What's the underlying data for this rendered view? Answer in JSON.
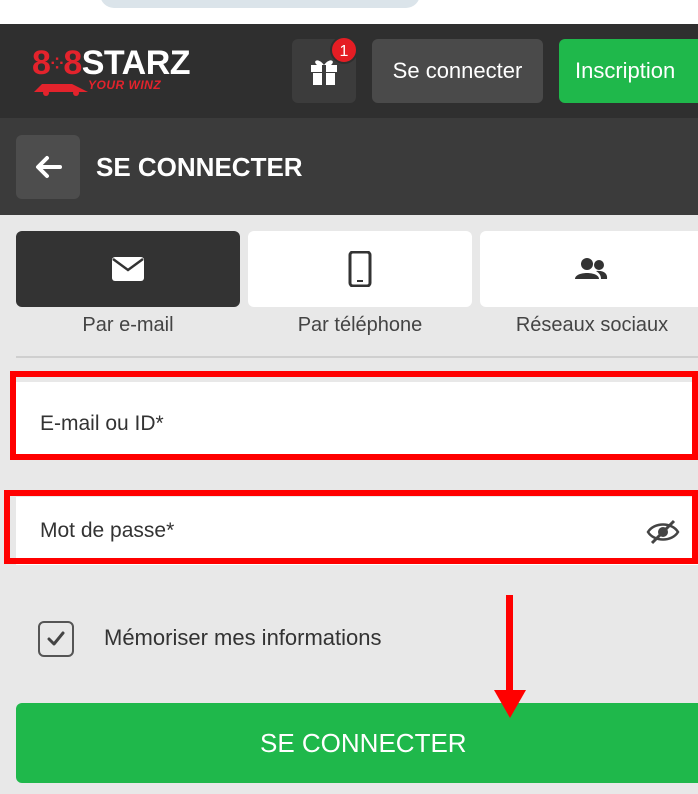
{
  "header": {
    "logo": {
      "main_left": "8",
      "main_mid": "8",
      "main_right": "STARZ",
      "tagline": "YOUR WINZ"
    },
    "gift_badge": "1",
    "login_label": "Se connecter",
    "register_label": "Inscription"
  },
  "page": {
    "title": "SE CONNECTER"
  },
  "tabs": [
    {
      "label": "Par e-mail",
      "icon": "envelope-icon",
      "active": true
    },
    {
      "label": "Par téléphone",
      "icon": "phone-icon",
      "active": false
    },
    {
      "label": "Réseaux sociaux",
      "icon": "users-icon",
      "active": false
    }
  ],
  "form": {
    "email_label": "E-mail ou ID*",
    "password_label": "Mot de passe*",
    "remember_label": "Mémoriser mes informations",
    "remember_checked": true,
    "submit_label": "SE CONNECTER"
  },
  "colors": {
    "accent_green": "#1fb84b",
    "brand_red": "#e3232c",
    "annotation_red": "#ff0000",
    "header_dark": "#2f2f2f"
  }
}
